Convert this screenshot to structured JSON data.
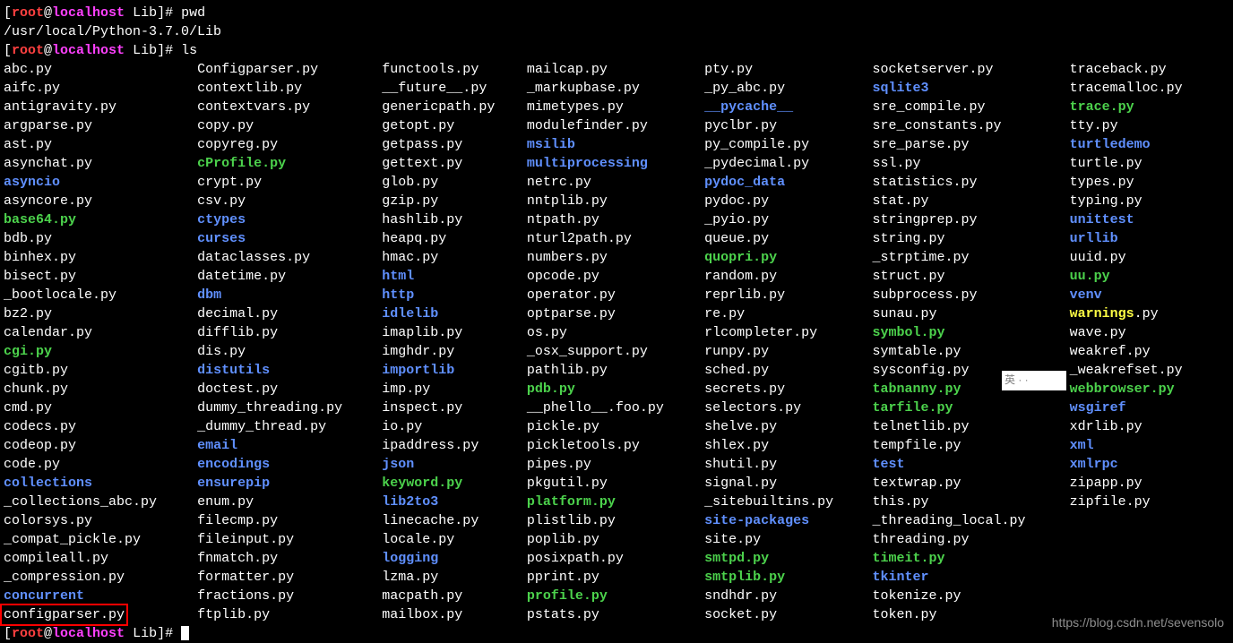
{
  "prompt": {
    "user": "root",
    "at": "@",
    "host": "localhost",
    "cwd": " Lib",
    "sign": "]# "
  },
  "cmd1": "pwd",
  "pwd_out": "/usr/local/Python-3.7.0/Lib",
  "cmd2": "ls",
  "watermark": "https://blog.csdn.net/sevensolo",
  "ime": "英",
  "ls": {
    "c0": [
      {
        "t": "abc.py",
        "c": "white"
      },
      {
        "t": "aifc.py",
        "c": "white"
      },
      {
        "t": "antigravity.py",
        "c": "white"
      },
      {
        "t": "argparse.py",
        "c": "white"
      },
      {
        "t": "ast.py",
        "c": "white"
      },
      {
        "t": "asynchat.py",
        "c": "white"
      },
      {
        "t": "asyncio",
        "c": "blue"
      },
      {
        "t": "asyncore.py",
        "c": "white"
      },
      {
        "t": "base64.py",
        "c": "green"
      },
      {
        "t": "bdb.py",
        "c": "white"
      },
      {
        "t": "binhex.py",
        "c": "white"
      },
      {
        "t": "bisect.py",
        "c": "white"
      },
      {
        "t": "_bootlocale.py",
        "c": "white"
      },
      {
        "t": "bz2.py",
        "c": "white"
      },
      {
        "t": "calendar.py",
        "c": "white"
      },
      {
        "t": "cgi.py",
        "c": "green"
      },
      {
        "t": "cgitb.py",
        "c": "white"
      },
      {
        "t": "chunk.py",
        "c": "white"
      },
      {
        "t": "cmd.py",
        "c": "white"
      },
      {
        "t": "codecs.py",
        "c": "white"
      },
      {
        "t": "codeop.py",
        "c": "white"
      },
      {
        "t": "code.py",
        "c": "white"
      },
      {
        "t": "collections",
        "c": "blue"
      },
      {
        "t": "_collections_abc.py",
        "c": "white"
      },
      {
        "t": "colorsys.py",
        "c": "white"
      },
      {
        "t": "_compat_pickle.py",
        "c": "white"
      },
      {
        "t": "compileall.py",
        "c": "white"
      },
      {
        "t": "_compression.py",
        "c": "white"
      },
      {
        "t": "concurrent",
        "c": "blue"
      },
      {
        "t": "configparser.py",
        "c": "white",
        "boxed": true
      }
    ],
    "c1": [
      {
        "t": "Configparser.py",
        "c": "white"
      },
      {
        "t": "contextlib.py",
        "c": "white"
      },
      {
        "t": "contextvars.py",
        "c": "white"
      },
      {
        "t": "copy.py",
        "c": "white"
      },
      {
        "t": "copyreg.py",
        "c": "white"
      },
      {
        "t": "cProfile.py",
        "c": "green"
      },
      {
        "t": "crypt.py",
        "c": "white"
      },
      {
        "t": "csv.py",
        "c": "white"
      },
      {
        "t": "ctypes",
        "c": "blue"
      },
      {
        "t": "curses",
        "c": "blue"
      },
      {
        "t": "dataclasses.py",
        "c": "white"
      },
      {
        "t": "datetime.py",
        "c": "white"
      },
      {
        "t": "dbm",
        "c": "blue"
      },
      {
        "t": "decimal.py",
        "c": "white"
      },
      {
        "t": "difflib.py",
        "c": "white"
      },
      {
        "t": "dis.py",
        "c": "white"
      },
      {
        "t": "distutils",
        "c": "blue"
      },
      {
        "t": "doctest.py",
        "c": "white"
      },
      {
        "t": "dummy_threading.py",
        "c": "white"
      },
      {
        "t": "_dummy_thread.py",
        "c": "white"
      },
      {
        "t": "email",
        "c": "blue"
      },
      {
        "t": "encodings",
        "c": "blue"
      },
      {
        "t": "ensurepip",
        "c": "blue"
      },
      {
        "t": "enum.py",
        "c": "white"
      },
      {
        "t": "filecmp.py",
        "c": "white"
      },
      {
        "t": "fileinput.py",
        "c": "white"
      },
      {
        "t": "fnmatch.py",
        "c": "white"
      },
      {
        "t": "formatter.py",
        "c": "white"
      },
      {
        "t": "fractions.py",
        "c": "white"
      },
      {
        "t": "ftplib.py",
        "c": "white"
      }
    ],
    "c2": [
      {
        "t": "functools.py",
        "c": "white"
      },
      {
        "t": "__future__.py",
        "c": "white"
      },
      {
        "t": "genericpath.py",
        "c": "white"
      },
      {
        "t": "getopt.py",
        "c": "white"
      },
      {
        "t": "getpass.py",
        "c": "white"
      },
      {
        "t": "gettext.py",
        "c": "white"
      },
      {
        "t": "glob.py",
        "c": "white"
      },
      {
        "t": "gzip.py",
        "c": "white"
      },
      {
        "t": "hashlib.py",
        "c": "white"
      },
      {
        "t": "heapq.py",
        "c": "white"
      },
      {
        "t": "hmac.py",
        "c": "white"
      },
      {
        "t": "html",
        "c": "blue"
      },
      {
        "t": "http",
        "c": "blue"
      },
      {
        "t": "idlelib",
        "c": "blue"
      },
      {
        "t": "imaplib.py",
        "c": "white"
      },
      {
        "t": "imghdr.py",
        "c": "white"
      },
      {
        "t": "importlib",
        "c": "blue"
      },
      {
        "t": "imp.py",
        "c": "white"
      },
      {
        "t": "inspect.py",
        "c": "white"
      },
      {
        "t": "io.py",
        "c": "white"
      },
      {
        "t": "ipaddress.py",
        "c": "white"
      },
      {
        "t": "json",
        "c": "blue"
      },
      {
        "t": "keyword.py",
        "c": "green"
      },
      {
        "t": "lib2to3",
        "c": "blue"
      },
      {
        "t": "linecache.py",
        "c": "white"
      },
      {
        "t": "locale.py",
        "c": "white"
      },
      {
        "t": "logging",
        "c": "blue"
      },
      {
        "t": "lzma.py",
        "c": "white"
      },
      {
        "t": "macpath.py",
        "c": "white"
      },
      {
        "t": "mailbox.py",
        "c": "white"
      }
    ],
    "c3": [
      {
        "t": "mailcap.py",
        "c": "white"
      },
      {
        "t": "_markupbase.py",
        "c": "white"
      },
      {
        "t": "mimetypes.py",
        "c": "white"
      },
      {
        "t": "modulefinder.py",
        "c": "white"
      },
      {
        "t": "msilib",
        "c": "blue"
      },
      {
        "t": "multiprocessing",
        "c": "blue"
      },
      {
        "t": "netrc.py",
        "c": "white"
      },
      {
        "t": "nntplib.py",
        "c": "white"
      },
      {
        "t": "ntpath.py",
        "c": "white"
      },
      {
        "t": "nturl2path.py",
        "c": "white"
      },
      {
        "t": "numbers.py",
        "c": "white"
      },
      {
        "t": "opcode.py",
        "c": "white"
      },
      {
        "t": "operator.py",
        "c": "white"
      },
      {
        "t": "optparse.py",
        "c": "white"
      },
      {
        "t": "os.py",
        "c": "white"
      },
      {
        "t": "_osx_support.py",
        "c": "white"
      },
      {
        "t": "pathlib.py",
        "c": "white"
      },
      {
        "t": "pdb.py",
        "c": "green"
      },
      {
        "t": "__phello__.foo.py",
        "c": "white"
      },
      {
        "t": "pickle.py",
        "c": "white"
      },
      {
        "t": "pickletools.py",
        "c": "white"
      },
      {
        "t": "pipes.py",
        "c": "white"
      },
      {
        "t": "pkgutil.py",
        "c": "white"
      },
      {
        "t": "platform.py",
        "c": "green"
      },
      {
        "t": "plistlib.py",
        "c": "white"
      },
      {
        "t": "poplib.py",
        "c": "white"
      },
      {
        "t": "posixpath.py",
        "c": "white"
      },
      {
        "t": "pprint.py",
        "c": "white"
      },
      {
        "t": "profile.py",
        "c": "green"
      },
      {
        "t": "pstats.py",
        "c": "white"
      }
    ],
    "c4": [
      {
        "t": "pty.py",
        "c": "white"
      },
      {
        "t": "_py_abc.py",
        "c": "white"
      },
      {
        "t": "__pycache__",
        "c": "blue"
      },
      {
        "t": "pyclbr.py",
        "c": "white"
      },
      {
        "t": "py_compile.py",
        "c": "white"
      },
      {
        "t": "_pydecimal.py",
        "c": "white"
      },
      {
        "t": "pydoc_data",
        "c": "blue"
      },
      {
        "t": "pydoc.py",
        "c": "white"
      },
      {
        "t": "_pyio.py",
        "c": "white"
      },
      {
        "t": "queue.py",
        "c": "white"
      },
      {
        "t": "quopri.py",
        "c": "green"
      },
      {
        "t": "random.py",
        "c": "white"
      },
      {
        "t": "reprlib.py",
        "c": "white"
      },
      {
        "t": "re.py",
        "c": "white"
      },
      {
        "t": "rlcompleter.py",
        "c": "white"
      },
      {
        "t": "runpy.py",
        "c": "white"
      },
      {
        "t": "sched.py",
        "c": "white"
      },
      {
        "t": "secrets.py",
        "c": "white"
      },
      {
        "t": "selectors.py",
        "c": "white"
      },
      {
        "t": "shelve.py",
        "c": "white"
      },
      {
        "t": "shlex.py",
        "c": "white"
      },
      {
        "t": "shutil.py",
        "c": "white"
      },
      {
        "t": "signal.py",
        "c": "white"
      },
      {
        "t": "_sitebuiltins.py",
        "c": "white"
      },
      {
        "t": "site-packages",
        "c": "blue"
      },
      {
        "t": "site.py",
        "c": "white"
      },
      {
        "t": "smtpd.py",
        "c": "green"
      },
      {
        "t": "smtplib.py",
        "c": "green"
      },
      {
        "t": "sndhdr.py",
        "c": "white"
      },
      {
        "t": "socket.py",
        "c": "white"
      }
    ],
    "c5": [
      {
        "t": "socketserver.py",
        "c": "white"
      },
      {
        "t": "sqlite3",
        "c": "blue"
      },
      {
        "t": "sre_compile.py",
        "c": "white"
      },
      {
        "t": "sre_constants.py",
        "c": "white"
      },
      {
        "t": "sre_parse.py",
        "c": "white"
      },
      {
        "t": "ssl.py",
        "c": "white"
      },
      {
        "t": "statistics.py",
        "c": "white"
      },
      {
        "t": "stat.py",
        "c": "white"
      },
      {
        "t": "stringprep.py",
        "c": "white"
      },
      {
        "t": "string.py",
        "c": "white"
      },
      {
        "t": "_strptime.py",
        "c": "white"
      },
      {
        "t": "struct.py",
        "c": "white"
      },
      {
        "t": "subprocess.py",
        "c": "white"
      },
      {
        "t": "sunau.py",
        "c": "white"
      },
      {
        "t": "symbol.py",
        "c": "green"
      },
      {
        "t": "symtable.py",
        "c": "white"
      },
      {
        "t": "sysconfig.py",
        "c": "white"
      },
      {
        "t": "tabnanny.py",
        "c": "green"
      },
      {
        "t": "tarfile.py",
        "c": "green"
      },
      {
        "t": "telnetlib.py",
        "c": "white"
      },
      {
        "t": "tempfile.py",
        "c": "white"
      },
      {
        "t": "test",
        "c": "blue"
      },
      {
        "t": "textwrap.py",
        "c": "white"
      },
      {
        "t": "this.py",
        "c": "white"
      },
      {
        "t": "_threading_local.py",
        "c": "white"
      },
      {
        "t": "threading.py",
        "c": "white"
      },
      {
        "t": "timeit.py",
        "c": "green"
      },
      {
        "t": "tkinter",
        "c": "blue"
      },
      {
        "t": "tokenize.py",
        "c": "white"
      },
      {
        "t": "token.py",
        "c": "white"
      }
    ],
    "c6": [
      {
        "t": "traceback.py",
        "c": "white"
      },
      {
        "t": "tracemalloc.py",
        "c": "white"
      },
      {
        "t": "trace.py",
        "c": "green"
      },
      {
        "t": "tty.py",
        "c": "white"
      },
      {
        "t": "turtledemo",
        "c": "blue"
      },
      {
        "t": "turtle.py",
        "c": "white"
      },
      {
        "t": "types.py",
        "c": "white"
      },
      {
        "t": "typing.py",
        "c": "white"
      },
      {
        "t": "unittest",
        "c": "blue"
      },
      {
        "t": "urllib",
        "c": "blue"
      },
      {
        "t": "uuid.py",
        "c": "white"
      },
      {
        "t": "uu.py",
        "c": "green"
      },
      {
        "t": "venv",
        "c": "blue"
      },
      {
        "t": "warnings",
        "c": "yellow",
        "suffix": ".py"
      },
      {
        "t": "wave.py",
        "c": "white"
      },
      {
        "t": "weakref.py",
        "c": "white"
      },
      {
        "t": "_weakrefset.py",
        "c": "white"
      },
      {
        "t": "webbrowser.py",
        "c": "green"
      },
      {
        "t": "wsgiref",
        "c": "blue"
      },
      {
        "t": "xdrlib.py",
        "c": "white"
      },
      {
        "t": "xml",
        "c": "blue"
      },
      {
        "t": "xmlrpc",
        "c": "blue"
      },
      {
        "t": "zipapp.py",
        "c": "white"
      },
      {
        "t": "zipfile.py",
        "c": "white"
      }
    ]
  }
}
